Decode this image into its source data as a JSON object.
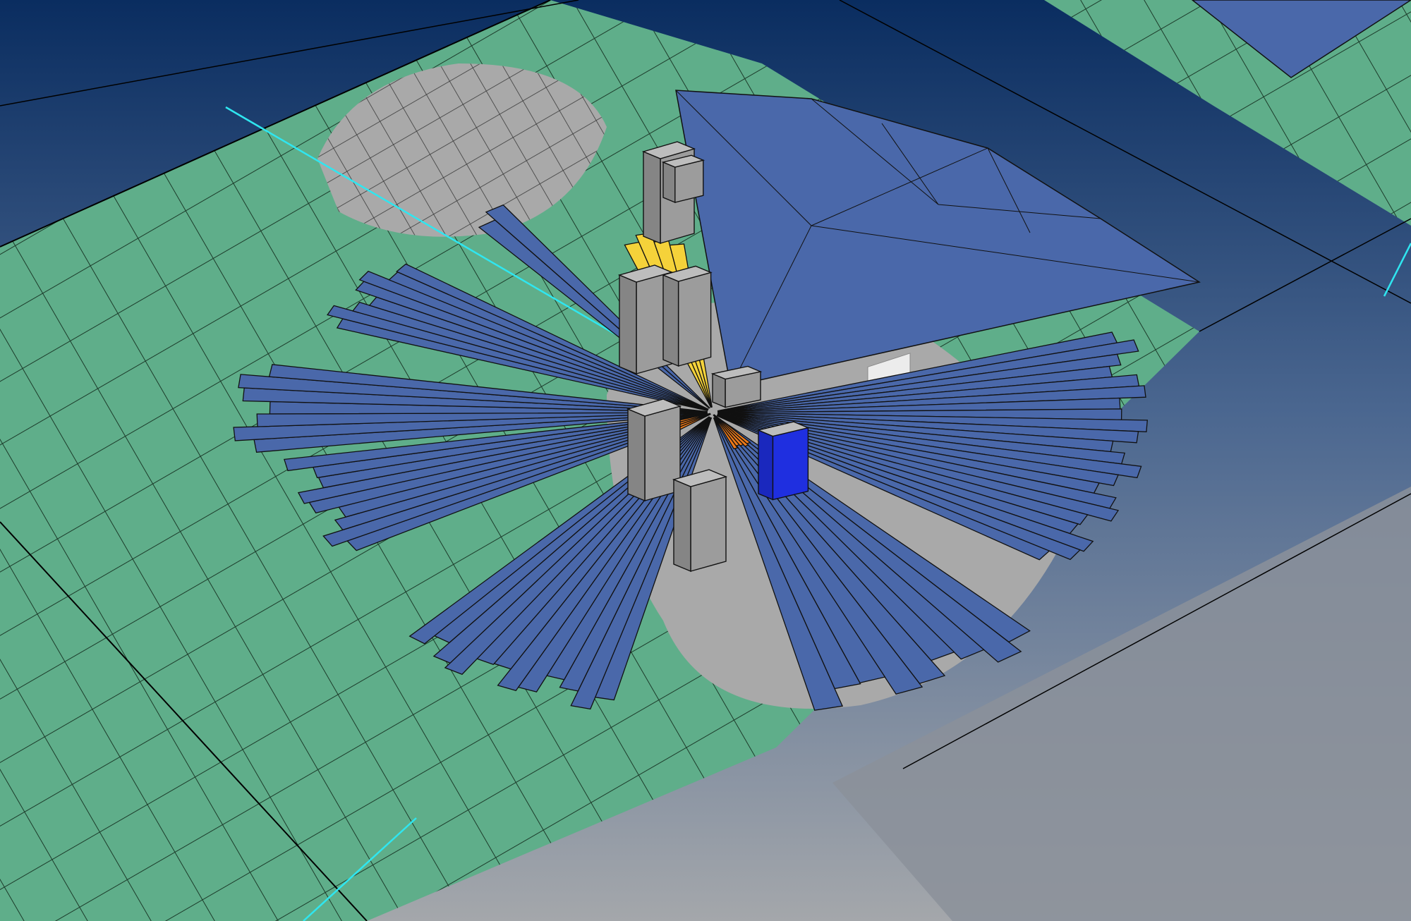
{
  "viewport": {
    "background_top": "#0a2d60",
    "background_bottom": "#9aa0a8"
  },
  "colors": {
    "ground_mesh": "#5fae8a",
    "gray_mesh": "#a9a9a9",
    "wedge_fill": "#4a68aa",
    "wedge_outline": "#111111",
    "yellow_wedge": "#f5d23a",
    "orange_wedge": "#ee7a1a",
    "selected_block": "#1f2fe0",
    "building": "#9c9c9c",
    "building_top": "#bdbdbd",
    "cyan_line": "#2fe6f0",
    "white_blocks": "#ececec"
  },
  "scene": {
    "wedge_groups": 10,
    "buildings": 8,
    "selected_buildings": 1
  }
}
